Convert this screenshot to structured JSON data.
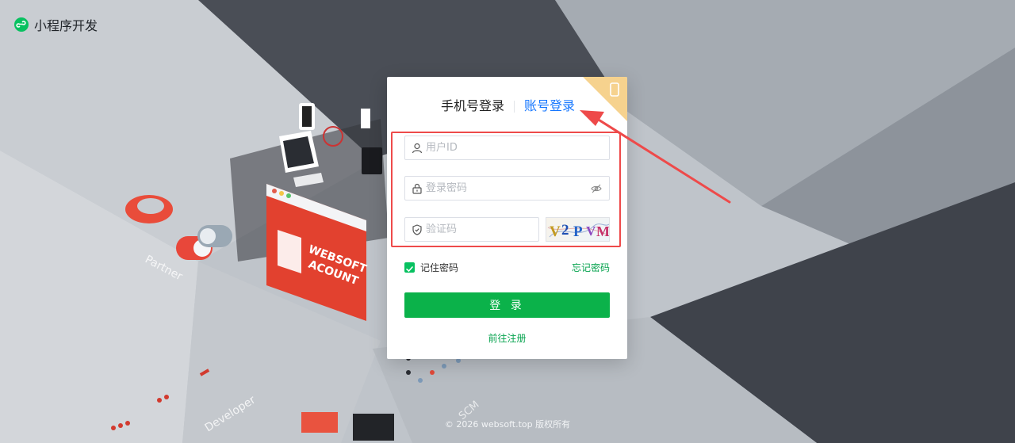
{
  "brand": {
    "name": "小程序开发"
  },
  "login": {
    "tabs": [
      {
        "label": "手机号登录",
        "active": false
      },
      {
        "label": "账号登录",
        "active": true
      }
    ],
    "user_id": {
      "placeholder": "用户ID",
      "value": ""
    },
    "password": {
      "placeholder": "登录密码",
      "value": ""
    },
    "captcha_input": {
      "placeholder": "验证码",
      "value": ""
    },
    "captcha_image_text": "V2PVM",
    "remember_label": "记住密码",
    "remember_checked": true,
    "forgot_label": "忘记密码",
    "submit_label": "登 录",
    "register_label": "前往注册",
    "corner_icon": "phone-icon"
  },
  "background_labels": {
    "partner": "Partner",
    "developer": "Developer",
    "scm": "SCM",
    "sign_line1": "WEBSOFT",
    "sign_line2": "ACOUNT"
  },
  "footer": {
    "text": "© 2026  websoft.top 版权所有"
  },
  "colors": {
    "accent_green": "#0bb24a",
    "link_blue": "#1677ff",
    "annotation_red": "#ee4a4a",
    "corner_gold": "#f6d28e"
  }
}
